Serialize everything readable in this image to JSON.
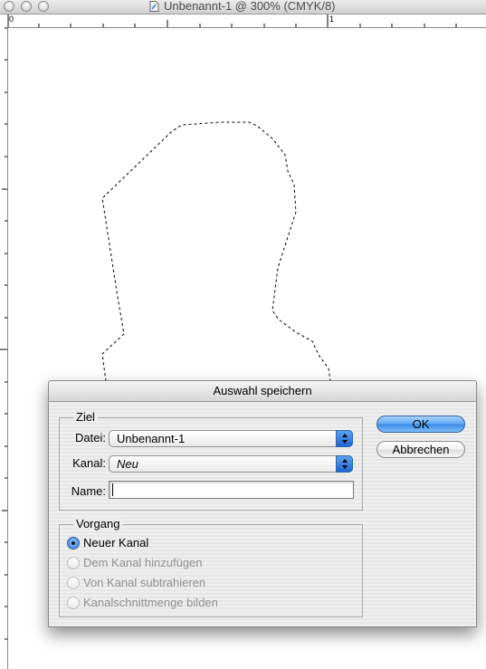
{
  "window": {
    "title": "Unbenannt-1 @ 300% (CMYK/8)"
  },
  "rulers": {
    "top_labels": [
      "0",
      "1"
    ]
  },
  "dialog": {
    "title": "Auswahl speichern",
    "ziel": {
      "legend": "Ziel",
      "datei_label": "Datei:",
      "datei_value": "Unbenannt-1",
      "kanal_label": "Kanal:",
      "kanal_value": "Neu",
      "name_label": "Name:",
      "name_value": ""
    },
    "vorgang": {
      "legend": "Vorgang",
      "options": [
        {
          "label": "Neuer Kanal",
          "selected": true,
          "enabled": true
        },
        {
          "label": "Dem Kanal hinzufügen",
          "selected": false,
          "enabled": false
        },
        {
          "label": "Von Kanal subtrahieren",
          "selected": false,
          "enabled": false
        },
        {
          "label": "Kanalschnittmenge bilden",
          "selected": false,
          "enabled": false
        }
      ]
    },
    "buttons": {
      "ok": "OK",
      "cancel": "Abbrechen"
    }
  },
  "colors": {
    "accent": "#3a88e5",
    "selection_outline": "#000000"
  }
}
